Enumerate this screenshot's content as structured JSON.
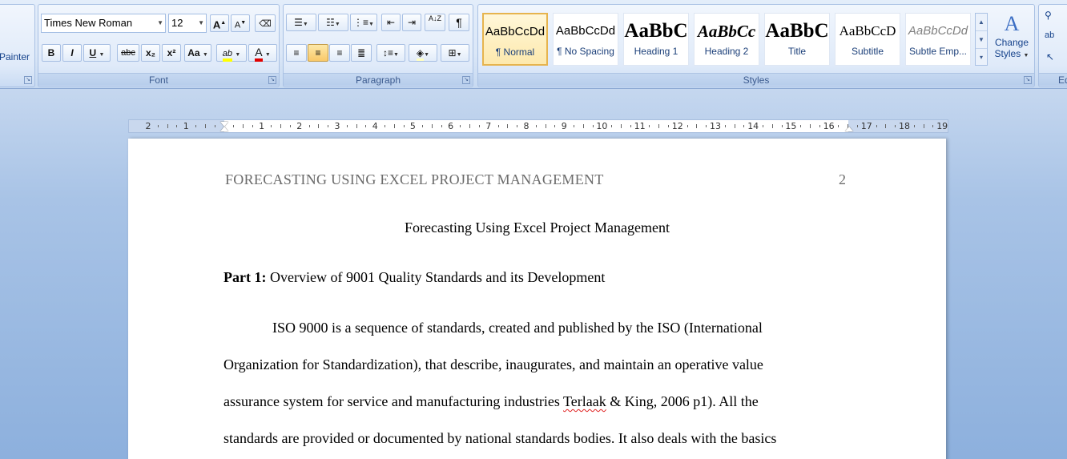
{
  "ribbon": {
    "clipboard": {
      "painter_label": "Painter"
    },
    "font": {
      "label": "Font",
      "font_name": "Times New Roman",
      "font_size": "12",
      "grow": "A",
      "shrink": "A",
      "bold": "B",
      "italic": "I",
      "underline": "U",
      "strike": "abc",
      "subscript": "x₂",
      "superscript": "x²",
      "change_case": "Aa",
      "highlight": "ab",
      "font_color": "A"
    },
    "paragraph": {
      "label": "Paragraph",
      "sort": "A↓Z",
      "pilcrow": "¶"
    },
    "styles": {
      "label": "Styles",
      "tiles": [
        {
          "sample": "AaBbCcDd",
          "name": "¶ Normal"
        },
        {
          "sample": "AaBbCcDd",
          "name": "¶ No Spacing"
        },
        {
          "sample": "AaBbC",
          "name": "Heading 1"
        },
        {
          "sample": "AaBbCc",
          "name": "Heading 2"
        },
        {
          "sample": "AaBbC",
          "name": "Title"
        },
        {
          "sample": "AaBbCcD",
          "name": "Subtitle"
        },
        {
          "sample": "AaBbCcDd",
          "name": "Subtle Emp..."
        }
      ],
      "change_styles_line1": "Change",
      "change_styles_line2": "Styles"
    },
    "editing": {
      "label": "Ed"
    }
  },
  "ruler": {
    "numbers": [
      "2",
      "1",
      "",
      "1",
      "2",
      "3",
      "4",
      "5",
      "6",
      "7",
      "8",
      "9",
      "10",
      "11",
      "12",
      "13",
      "14",
      "15",
      "16",
      "17",
      "18",
      "19"
    ]
  },
  "document": {
    "running_head": "FORECASTING  USING  EXCEL PROJECT  MANAGEMENT",
    "page_number": "2",
    "title": "Forecasting Using Excel Project Management",
    "heading_bold": "Part 1:",
    "heading_rest": " Overview of 9001 Quality Standards and its Development",
    "lines": [
      "ISO 9000 is a sequence of standards, created and published by the ISO (International",
      "Organization for Standardization), that describe, inaugurates, and maintain an operative value",
      "assurance system for service and manufacturing industries ",
      "standards are provided or documented by national standards bodies.  It also deals with the basics"
    ],
    "line3_flagged": "Terlaak",
    "line3_rest": " & King, 2006 p1). All the"
  },
  "colors": {
    "highlight": "#ffff00",
    "font_color": "#e00000",
    "ribbon_text": "#15428b"
  }
}
